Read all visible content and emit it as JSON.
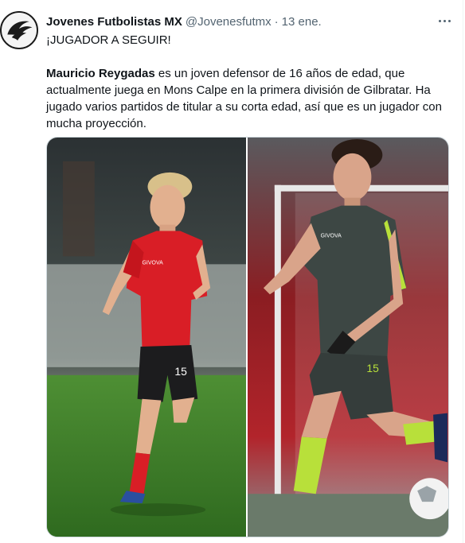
{
  "tweet": {
    "author_name": "Jovenes Futbolistas MX",
    "handle": "@Jovenesfutmx",
    "separator": "·",
    "date": "13 ene.",
    "headline": "¡JUGADOR A SEGUIR!",
    "player_name": "Mauricio Reygadas",
    "body": " es un joven defensor de 16 años de edad, que actualmente juega en Mons Calpe en la primera división de Gilbratar. Ha jugado varios partidos de titular a su corta edad, así que es un jugador con mucha proyección."
  },
  "media": {
    "left_photo": {
      "jersey_number": "15",
      "sponsor": "GIVOVA",
      "kit_color": "#d91e26"
    },
    "right_photo": {
      "jersey_number": "15",
      "sponsor": "GIVOVA",
      "kit_color": "#3d4744"
    }
  },
  "icons": {
    "avatar": "eagle-logo-icon",
    "more": "more-dots-icon"
  },
  "colors": {
    "text": "#0f1419",
    "secondary": "#536471",
    "border": "#cfd9de"
  }
}
